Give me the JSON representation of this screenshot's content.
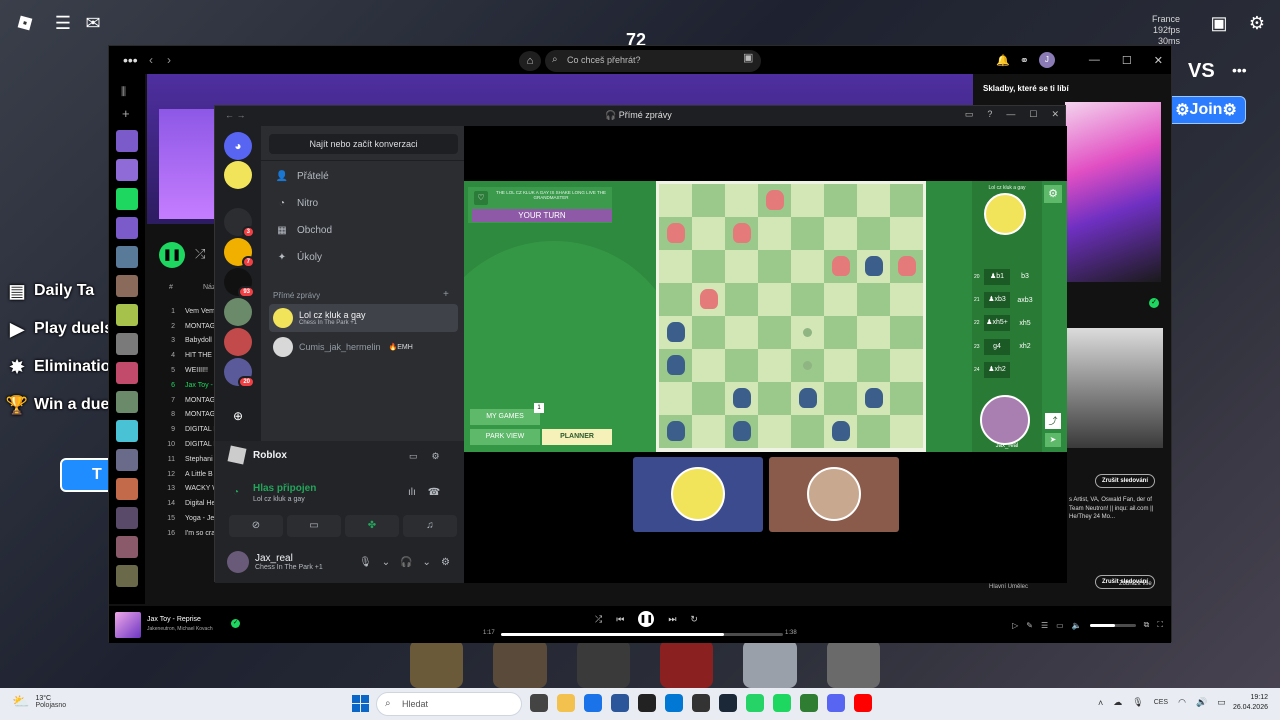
{
  "roblox": {
    "score": "72",
    "region": [
      "France",
      "192fps",
      "30ms"
    ],
    "left_list": [
      {
        "icon": "calendar-icon",
        "label": "Daily Ta"
      },
      {
        "icon": "play-icon",
        "label": "Play duels"
      },
      {
        "icon": "elimination-icon",
        "label": "Eliminatio"
      },
      {
        "icon": "trophy-icon",
        "label": "Win a due"
      }
    ],
    "to_button": "T",
    "vs": "VS",
    "join_button": "Join"
  },
  "spotify": {
    "search_placeholder": "Co chceš přehrát?",
    "sidebar_covers": [
      "#7b5ac9",
      "#8e6bd6",
      "#1ed760",
      "#7b5ac9",
      "#5a7a9a",
      "#8a6a5a",
      "#a6c24a",
      "#7a7a7a",
      "#c24a6a",
      "#6a8a6a",
      "#4ac2d6",
      "#6a6a8a",
      "#c26a4a",
      "#5a4a6a",
      "#8a5a6a",
      "#6a6a4a"
    ],
    "table_header": {
      "hash": "#",
      "title": "Název"
    },
    "tracks": [
      {
        "n": "1",
        "title": "Vem Vem"
      },
      {
        "n": "2",
        "title": "MONTAG"
      },
      {
        "n": "3",
        "title": "Babydoll"
      },
      {
        "n": "4",
        "title": "HIT THE J"
      },
      {
        "n": "5",
        "title": "WEIIII!!"
      },
      {
        "n": "6",
        "title": "Jax Toy -",
        "active": true
      },
      {
        "n": "7",
        "title": "MONTAG"
      },
      {
        "n": "8",
        "title": "MONTAG"
      },
      {
        "n": "9",
        "title": "DIGITAL F"
      },
      {
        "n": "10",
        "title": "DIGITAL F"
      },
      {
        "n": "11",
        "title": "Stephani"
      },
      {
        "n": "12",
        "title": "A Little B"
      },
      {
        "n": "13",
        "title": "WACKY W"
      },
      {
        "n": "14",
        "title": "Digital He"
      },
      {
        "n": "15",
        "title": "Yoga - Je"
      },
      {
        "n": "16",
        "title": "I'm so cra"
      }
    ],
    "right_panel_title": "Skladby, které se ti líbí",
    "follow_label": "Zrušit sledování",
    "artist_bio": "s Artist, VA, Oswald Fan, der of Team Neutron! || inqu: ail.com || He/They 24 Mo...",
    "show_all": "Zobrazit vše",
    "main_artist": "Hlavní Umělec",
    "now_playing": {
      "title": "Jax Toy - Reprise",
      "artist": "Jakeneutron, Michael Kovach",
      "elapsed": "1:17",
      "duration": "1:38",
      "progress": 0.79,
      "volume": 0.55
    }
  },
  "discord": {
    "title": "Přímé zprávy",
    "find_placeholder": "Najít nebo začít konverzaci",
    "servers": [
      {
        "color": "#5865f2",
        "icon": "discord-icon",
        "badge": ""
      },
      {
        "color": "#f1e45b",
        "icon": "avatar",
        "badge": ""
      },
      {
        "color": "#2b2d31",
        "icon": "avatar",
        "badge": "3"
      },
      {
        "color": "#f1b000",
        "icon": "avatar",
        "badge": "7"
      },
      {
        "color": "#111111",
        "icon": "avatar",
        "badge": "93"
      },
      {
        "color": "#6a8a6a",
        "icon": "avatar",
        "badge": ""
      },
      {
        "color": "#c24a4a",
        "icon": "avatar",
        "badge": ""
      },
      {
        "color": "#5a5a9a",
        "icon": "avatar",
        "badge": "20"
      }
    ],
    "nav": [
      {
        "icon": "friends-icon",
        "label": "Přátelé"
      },
      {
        "icon": "nitro-icon",
        "label": "Nitro"
      },
      {
        "icon": "shop-icon",
        "label": "Obchod"
      },
      {
        "icon": "quests-icon",
        "label": "Úkoly"
      }
    ],
    "dm_header": "Přímé zprávy",
    "conversations": [
      {
        "name": "Lol cz kluk a gay",
        "status": "Chess In The Park +1",
        "active": true
      },
      {
        "name": "Cumis_jak_hermelin",
        "tag": "EMH",
        "active": false
      }
    ],
    "activity_name": "Roblox",
    "voice": {
      "title": "Hlas připojen",
      "channel": "Lol cz kluk a gay"
    },
    "me": {
      "name": "Jax_real",
      "status": "Chess In The Park +1"
    }
  },
  "chess": {
    "banner_text": "THE LOL CZ KLUK A GAY IS SHAKE LONG LIVE THE GRANDMASTER",
    "your_turn": "YOUR TURN",
    "my_games": "MY GAMES",
    "my_games_count": "1",
    "park_view": "PARK VIEW",
    "planner": "PLANNER",
    "opponent": "Lol cz kluk a gay",
    "me": "Jax_real",
    "moves": [
      {
        "n": "20",
        "w": "♟b1",
        "b": "b3"
      },
      {
        "n": "21",
        "w": "♟xb3",
        "b": "axb3"
      },
      {
        "n": "22",
        "w": "♟xh5+",
        "b": "xh5"
      },
      {
        "n": "23",
        "w": "g4",
        "b": "xh2"
      },
      {
        "n": "24",
        "w": "♟xh2",
        "b": ""
      }
    ],
    "board": [
      [
        "",
        "",
        "",
        "red",
        "",
        "",
        "",
        ""
      ],
      [
        "red",
        "",
        "red",
        "",
        "",
        "",
        "",
        ""
      ],
      [
        "",
        "",
        "",
        "",
        "",
        "red",
        "blue",
        "red"
      ],
      [
        "",
        "red",
        "",
        "",
        "",
        "",
        "",
        ""
      ],
      [
        "blue",
        "",
        "",
        "",
        "dot",
        "",
        "",
        ""
      ],
      [
        "blue",
        "",
        "",
        "",
        "dot",
        "",
        "",
        ""
      ],
      [
        "",
        "",
        "blue",
        "",
        "blue",
        "",
        "blue",
        ""
      ],
      [
        "blue",
        "",
        "blue",
        "",
        "",
        "blue",
        "",
        ""
      ]
    ]
  },
  "taskbar": {
    "temp": "13°C",
    "weather": "Polojasno",
    "search_placeholder": "Hledat",
    "apps": [
      {
        "color": "#444444"
      },
      {
        "color": "#f2c14e"
      },
      {
        "color": "#1a73e8"
      },
      {
        "color": "#2b579a"
      },
      {
        "color": "#222222"
      },
      {
        "color": "#0078d4"
      },
      {
        "color": "#333333"
      },
      {
        "color": "#1b2838"
      },
      {
        "color": "#25d366"
      },
      {
        "color": "#1ed760"
      },
      {
        "color": "#2e7d32"
      },
      {
        "color": "#5865f2"
      },
      {
        "color": "#ff0000"
      }
    ],
    "lang": "CES",
    "time": "19:12",
    "date": "26.04.2026"
  }
}
